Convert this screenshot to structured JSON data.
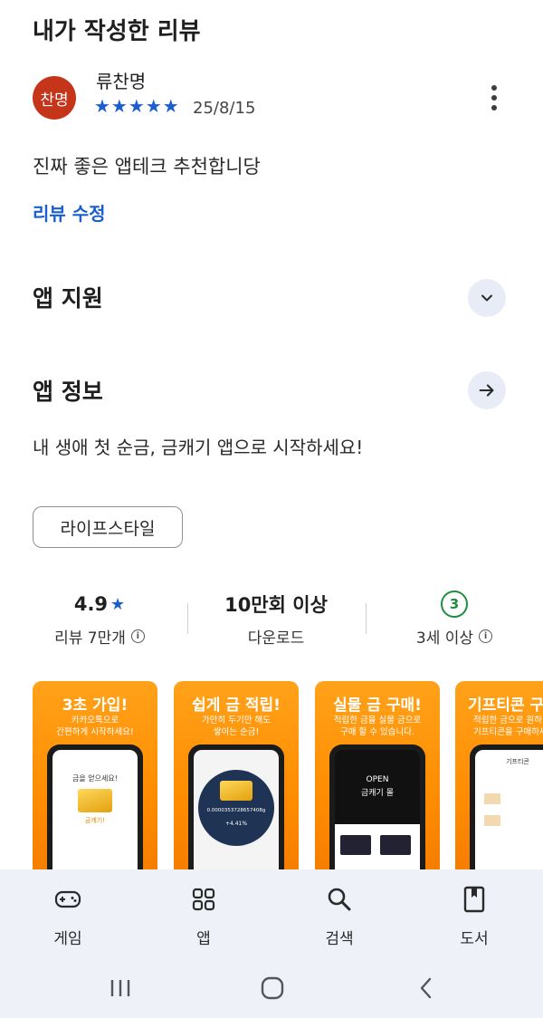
{
  "page": {
    "title": "내가 작성한 리뷰"
  },
  "review": {
    "avatar_text": "찬명",
    "avatar_color": "#c4351a",
    "reviewer_name": "류찬명",
    "rating": 5,
    "stars": "★★★★★",
    "date": "25/8/15",
    "text": "진짜 좋은 앱테크 추천합니당",
    "edit_label": "리뷰 수정",
    "more_icon": "more-vert-icon"
  },
  "sections": {
    "app_support": {
      "title": "앱 지원",
      "icon": "chevron-down-icon"
    },
    "app_info": {
      "title": "앱 정보",
      "icon": "arrow-right-icon",
      "description": "내 생애 첫 순금, 금캐기 앱으로 시작하세요!"
    }
  },
  "category_chip": "라이프스타일",
  "stats": {
    "rating": {
      "value": "4.9",
      "star": "★",
      "label": "리뷰 7만개"
    },
    "downloads": {
      "value": "10만회 이상",
      "label": "다운로드"
    },
    "age": {
      "badge": "3",
      "label": "3세 이상"
    }
  },
  "screenshots": [
    {
      "title": "3초 가입!",
      "subtitle": "카카오톡으로\n간편하게 시작하세요!",
      "screen_text": "금을 얻으세요!",
      "screen_sub": "금캐기!"
    },
    {
      "title": "쉽게 금 적립!",
      "subtitle": "가만히 두기만 해도\n쌓이는 순금!",
      "screen_text": "0.0000353728657408g",
      "screen_sub": "+4.41%"
    },
    {
      "title": "실물 금 구매!",
      "subtitle": "적립한 금을 실물 금으로\n구매 할 수 있습니다.",
      "screen_text": "OPEN",
      "screen_sub": "금캐기 몰"
    },
    {
      "title": "기프티콘 구",
      "subtitle": "적립한 금으로 원하\n기프티콘을 구매하세",
      "screen_text": "기프티콘",
      "screen_sub": ""
    }
  ],
  "bottom_nav": [
    {
      "label": "게임",
      "icon": "gamepad-icon"
    },
    {
      "label": "앱",
      "icon": "apps-grid-icon"
    },
    {
      "label": "검색",
      "icon": "search-icon"
    },
    {
      "label": "도서",
      "icon": "book-icon"
    }
  ],
  "colors": {
    "accent_blue": "#1a5fd0",
    "age_green": "#1e8e3e",
    "nav_bg": "#eef1f8",
    "screenshot_orange": "#ff8c00"
  }
}
